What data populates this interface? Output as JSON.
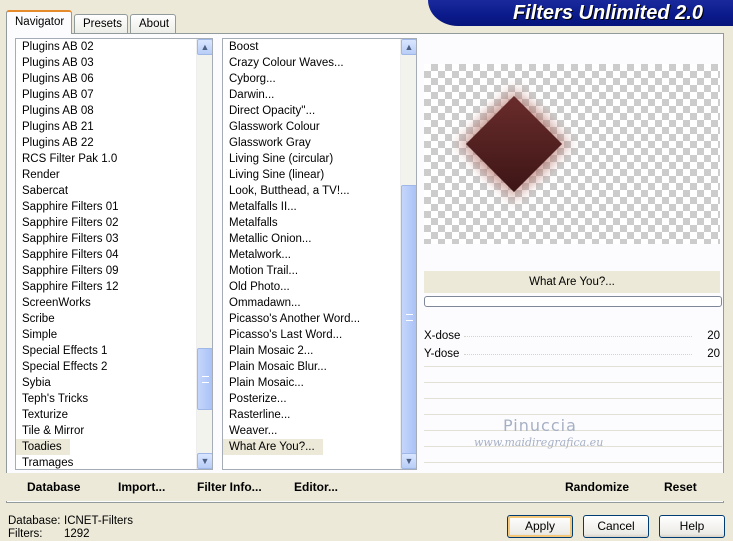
{
  "tabs": [
    {
      "label": "Navigator",
      "active": true
    },
    {
      "label": "Presets",
      "active": false
    },
    {
      "label": "About",
      "active": false
    }
  ],
  "banner": {
    "title": "Filters Unlimited 2.0"
  },
  "categories": {
    "items": [
      "Plugins AB 02",
      "Plugins AB 03",
      "Plugins AB 06",
      "Plugins AB 07",
      "Plugins AB 08",
      "Plugins AB 21",
      "Plugins AB 22",
      "RCS Filter Pak 1.0",
      "Render",
      "Sabercat",
      "Sapphire Filters 01",
      "Sapphire Filters 02",
      "Sapphire Filters 03",
      "Sapphire Filters 04",
      "Sapphire Filters 09",
      "Sapphire Filters 12",
      "ScreenWorks",
      "Scribe",
      "Simple",
      "Special Effects 1",
      "Special Effects 2",
      "Sybia",
      "Teph's Tricks",
      "Texturize",
      "Tile & Mirror",
      "Toadies",
      "Tramages"
    ],
    "selected": "Toadies"
  },
  "filters": {
    "items": [
      "Boost",
      "Crazy Colour Waves...",
      "Cyborg...",
      "Darwin...",
      "Direct Opacity''...",
      "Glasswork Colour",
      "Glasswork Gray",
      "Living Sine (circular)",
      "Living Sine (linear)",
      "Look, Butthead, a TV!...",
      "Metalfalls II...",
      "Metalfalls",
      "Metallic Onion...",
      "Metalwork...",
      "Motion Trail...",
      "Old Photo...",
      "Ommadawn...",
      "Picasso's Another Word...",
      "Picasso's Last Word...",
      "Plain Mosaic 2...",
      "Plain Mosaic Blur...",
      "Plain Mosaic...",
      "Posterize...",
      "Rasterline...",
      "Weaver...",
      "What Are You?..."
    ],
    "selected": "What Are You?..."
  },
  "preview": {
    "filter_name": "What Are You?..."
  },
  "params": [
    {
      "name": "X-dose",
      "value": "20"
    },
    {
      "name": "Y-dose",
      "value": "20"
    }
  ],
  "watermark": {
    "name": "Pinuccia",
    "url": "www.maidiregrafica.eu"
  },
  "actions": {
    "database": "Database",
    "import": "Import...",
    "filter_info": "Filter Info...",
    "editor": "Editor...",
    "randomize": "Randomize",
    "reset": "Reset"
  },
  "status": {
    "database_label": "Database:",
    "database_value": "ICNET-Filters",
    "filters_label": "Filters:",
    "filters_value": "1292"
  },
  "dialog": {
    "apply": "Apply",
    "cancel": "Cancel",
    "help": "Help"
  },
  "colors": {
    "banner": "#0b1a8a",
    "selection": "#ece9d8",
    "diamond": "#5a2424"
  }
}
